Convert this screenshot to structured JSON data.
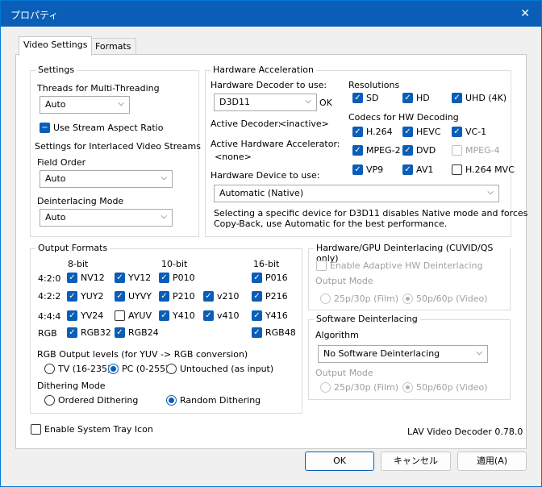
{
  "window": {
    "title": "プロパティ",
    "close_icon": "close-icon"
  },
  "tabs": [
    {
      "label": "Video Settings"
    },
    {
      "label": "Formats"
    }
  ],
  "settings": {
    "group_label": "Settings",
    "threads_label": "Threads for Multi-Threading",
    "threads_value": "Auto",
    "stream_aspect_label": "Use Stream Aspect Ratio",
    "interlaced_label": "Settings for Interlaced Video Streams",
    "field_order_label": "Field Order",
    "field_order_value": "Auto",
    "deinterlacing_mode_label": "Deinterlacing Mode",
    "deinterlacing_mode_value": "Auto"
  },
  "hwaccel": {
    "group_label": "Hardware Acceleration",
    "decoder_label": "Hardware Decoder to use:",
    "decoder_value": "D3D11",
    "decoder_status": "OK",
    "active_decoder_label": "Active Decoder:",
    "active_decoder_value": "<inactive>",
    "active_accel_label": "Active Hardware Accelerator:",
    "active_accel_value": "<none>",
    "device_label": "Hardware Device to use:",
    "device_value": "Automatic (Native)",
    "note_line1": "Selecting a specific device for D3D11 disables Native mode and forces",
    "note_line2": "Copy-Back, use Automatic for the best performance.",
    "resolutions_label": "Resolutions",
    "resolutions": [
      "SD",
      "HD",
      "UHD (4K)"
    ],
    "codecs_label": "Codecs for HW Decoding",
    "codecs": [
      "H.264",
      "HEVC",
      "VC-1",
      "MPEG-2",
      "DVD",
      "MPEG-4",
      "VP9",
      "AV1",
      "H.264 MVC"
    ]
  },
  "output": {
    "group_label": "Output Formats",
    "col_8bit": "8-bit",
    "col_10bit": "10-bit",
    "col_16bit": "16-bit",
    "rows": [
      "4:2:0",
      "4:2:2",
      "4:4:4",
      "RGB"
    ],
    "formats": [
      "NV12",
      "YV12",
      "P010",
      "P016",
      "YUY2",
      "UYVY",
      "P210",
      "v210",
      "P216",
      "YV24",
      "AYUV",
      "Y410",
      "v410",
      "Y416",
      "RGB32",
      "RGB24",
      "RGB48"
    ],
    "levels_label": "RGB Output levels (for YUV -> RGB conversion)",
    "levels": [
      "TV (16-235)",
      "PC (0-255)",
      "Untouched (as input)"
    ],
    "dither_label": "Dithering Mode",
    "dither": [
      "Ordered Dithering",
      "Random Dithering"
    ]
  },
  "hwdeint": {
    "group_label": "Hardware/GPU Deinterlacing (CUVID/QS only)",
    "adaptive_label": "Enable Adaptive HW Deinterlacing",
    "output_mode_label": "Output Mode",
    "modes": [
      "25p/30p (Film)",
      "50p/60p (Video)"
    ]
  },
  "swdeint": {
    "group_label": "Software Deinterlacing",
    "algorithm_label": "Algorithm",
    "algorithm_value": "No Software Deinterlacing",
    "output_mode_label": "Output Mode",
    "modes": [
      "25p/30p (Film)",
      "50p/60p (Video)"
    ]
  },
  "footer": {
    "tray_label": "Enable System Tray Icon",
    "version": "LAV Video Decoder 0.78.0",
    "ok": "OK",
    "cancel": "キャンセル",
    "apply": "適用(A)"
  },
  "colors": {
    "accent": "#0a5eb7",
    "titlebar": "#0a5eb7",
    "disabled_text": "#a0a0a0"
  }
}
